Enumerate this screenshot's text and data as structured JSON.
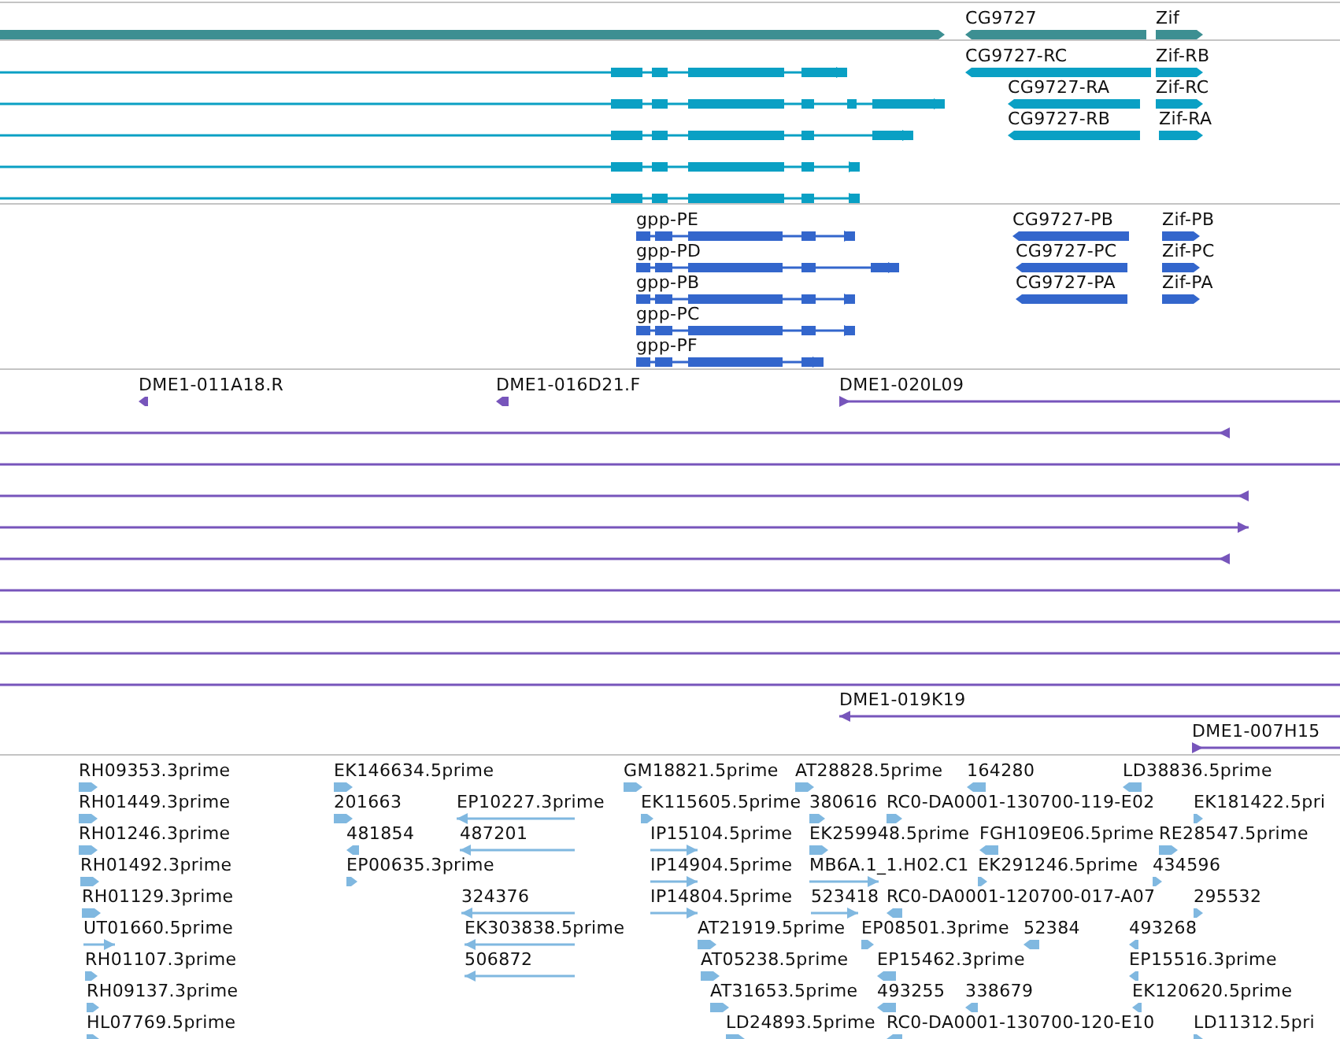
{
  "tracks": [
    {
      "kind": "genes",
      "color": "#3d8f92",
      "features": [
        {
          "reverse": false
        },
        {
          "label": "CG9727",
          "reverse": true
        },
        {
          "label": "Zif",
          "reverse": false
        }
      ]
    },
    {
      "kind": "transcripts",
      "color": "#0aa0c4",
      "features": [
        {
          "reverse": false
        },
        {
          "reverse": false
        },
        {
          "reverse": false
        },
        {
          "reverse": false
        },
        {
          "reverse": false
        },
        {
          "label": "CG9727-RC",
          "reverse": true
        },
        {
          "label": "Zif-RB",
          "reverse": false
        },
        {
          "label": "CG9727-RA",
          "reverse": true
        },
        {
          "label": "Zif-RC",
          "reverse": false
        },
        {
          "label": "CG9727-RB",
          "reverse": true
        },
        {
          "label": "Zif-RA",
          "reverse": false
        }
      ]
    },
    {
      "kind": "proteins",
      "color": "#3366cc",
      "features": [
        {
          "label": "gpp-PE",
          "reverse": false
        },
        {
          "label": "CG9727-PB",
          "reverse": true
        },
        {
          "label": "Zif-PB",
          "reverse": false
        },
        {
          "label": "gpp-PD",
          "reverse": false
        },
        {
          "label": "CG9727-PC",
          "reverse": true
        },
        {
          "label": "Zif-PC",
          "reverse": false
        },
        {
          "label": "gpp-PB",
          "reverse": false
        },
        {
          "label": "CG9727-PA",
          "reverse": true
        },
        {
          "label": "Zif-PA",
          "reverse": false
        },
        {
          "label": "gpp-PC",
          "reverse": false
        },
        {
          "label": "gpp-PF",
          "reverse": false
        }
      ]
    },
    {
      "kind": "clones",
      "color": "#7755bb",
      "features": [
        {
          "label": "DME1-011A18.R",
          "reverse": true,
          "clipped": false
        },
        {
          "label": "DME1-016D21.F",
          "reverse": true,
          "clipped": false
        },
        {
          "label": "DME1-020L09",
          "reverse": false,
          "clipped": false
        },
        {
          "reverse": true,
          "clipped": false
        },
        {
          "reverse": false,
          "clipped": true
        },
        {
          "reverse": true,
          "clipped": false
        },
        {
          "reverse": false,
          "clipped": false
        },
        {
          "reverse": true,
          "clipped": false
        },
        {
          "reverse": false,
          "clipped": true
        },
        {
          "reverse": false,
          "clipped": true
        },
        {
          "reverse": false,
          "clipped": true
        },
        {
          "reverse": false,
          "clipped": true
        },
        {
          "label": "DME1-019K19",
          "reverse": true,
          "clipped": false
        },
        {
          "label": "DME1-007H15",
          "reverse": false,
          "clipped": false
        }
      ]
    },
    {
      "kind": "ests",
      "color": "#80b8e0",
      "features": [
        {
          "label": "RH09353.3prime",
          "reverse": false
        },
        {
          "label": "EK146634.5prime",
          "reverse": false
        },
        {
          "label": "GM18821.5prime",
          "reverse": false
        },
        {
          "label": "AT28828.5prime",
          "reverse": false
        },
        {
          "label": "164280",
          "reverse": true
        },
        {
          "label": "LD38836.5prime",
          "reverse": true
        },
        {
          "label": "RH01449.3prime",
          "reverse": false
        },
        {
          "label": "201663",
          "reverse": false
        },
        {
          "label": "EP10227.3prime",
          "reverse": true
        },
        {
          "label": "EK115605.5prime",
          "reverse": false
        },
        {
          "label": "380616",
          "reverse": false
        },
        {
          "label": "RC0-DA0001-130700-119-E02",
          "reverse": false
        },
        {
          "label": "EK181422.5pri",
          "reverse": false
        },
        {
          "label": "RH01246.3prime",
          "reverse": false
        },
        {
          "label": "481854",
          "reverse": true
        },
        {
          "label": "487201",
          "reverse": true
        },
        {
          "label": "IP15104.5prime",
          "reverse": false
        },
        {
          "label": "EK259948.5prime",
          "reverse": false
        },
        {
          "label": "FGH109E06.5prime",
          "reverse": true
        },
        {
          "label": "RE28547.5prime",
          "reverse": false
        },
        {
          "label": "RH01492.3prime",
          "reverse": false
        },
        {
          "label": "EP00635.3prime",
          "reverse": false
        },
        {
          "label": "IP14904.5prime",
          "reverse": false
        },
        {
          "label": "MB6A.1_1.H02.C1",
          "reverse": false
        },
        {
          "label": "EK291246.5prime",
          "reverse": false
        },
        {
          "label": "434596",
          "reverse": false
        },
        {
          "label": "RH01129.3prime",
          "reverse": false
        },
        {
          "label": "324376",
          "reverse": true
        },
        {
          "label": "IP14804.5prime",
          "reverse": false
        },
        {
          "label": "523418",
          "reverse": false
        },
        {
          "label": "RC0-DA0001-120700-017-A07",
          "reverse": true
        },
        {
          "label": "295532",
          "reverse": false
        },
        {
          "label": "UT01660.5prime",
          "reverse": false
        },
        {
          "label": "EK303838.5prime",
          "reverse": true
        },
        {
          "label": "AT21919.5prime",
          "reverse": false
        },
        {
          "label": "EP08501.3prime",
          "reverse": false
        },
        {
          "label": "52384",
          "reverse": true
        },
        {
          "label": "493268",
          "reverse": true
        },
        {
          "label": "RH01107.3prime",
          "reverse": false
        },
        {
          "label": "506872",
          "reverse": true
        },
        {
          "label": "AT05238.5prime",
          "reverse": false
        },
        {
          "label": "EP15462.3prime",
          "reverse": true
        },
        {
          "label": "EP15516.3prime",
          "reverse": true
        },
        {
          "label": "RH09137.3prime",
          "reverse": false
        },
        {
          "label": "AT31653.5prime",
          "reverse": false
        },
        {
          "label": "493255",
          "reverse": true
        },
        {
          "label": "338679",
          "reverse": true
        },
        {
          "label": "EK120620.5prime",
          "reverse": true
        },
        {
          "label": "HL07769.5prime",
          "reverse": false
        },
        {
          "label": "LD24893.5prime",
          "reverse": false
        },
        {
          "label": "RC0-DA0001-130700-120-E10",
          "reverse": true
        },
        {
          "label": "LD11312.5pri",
          "reverse": false
        }
      ]
    }
  ]
}
